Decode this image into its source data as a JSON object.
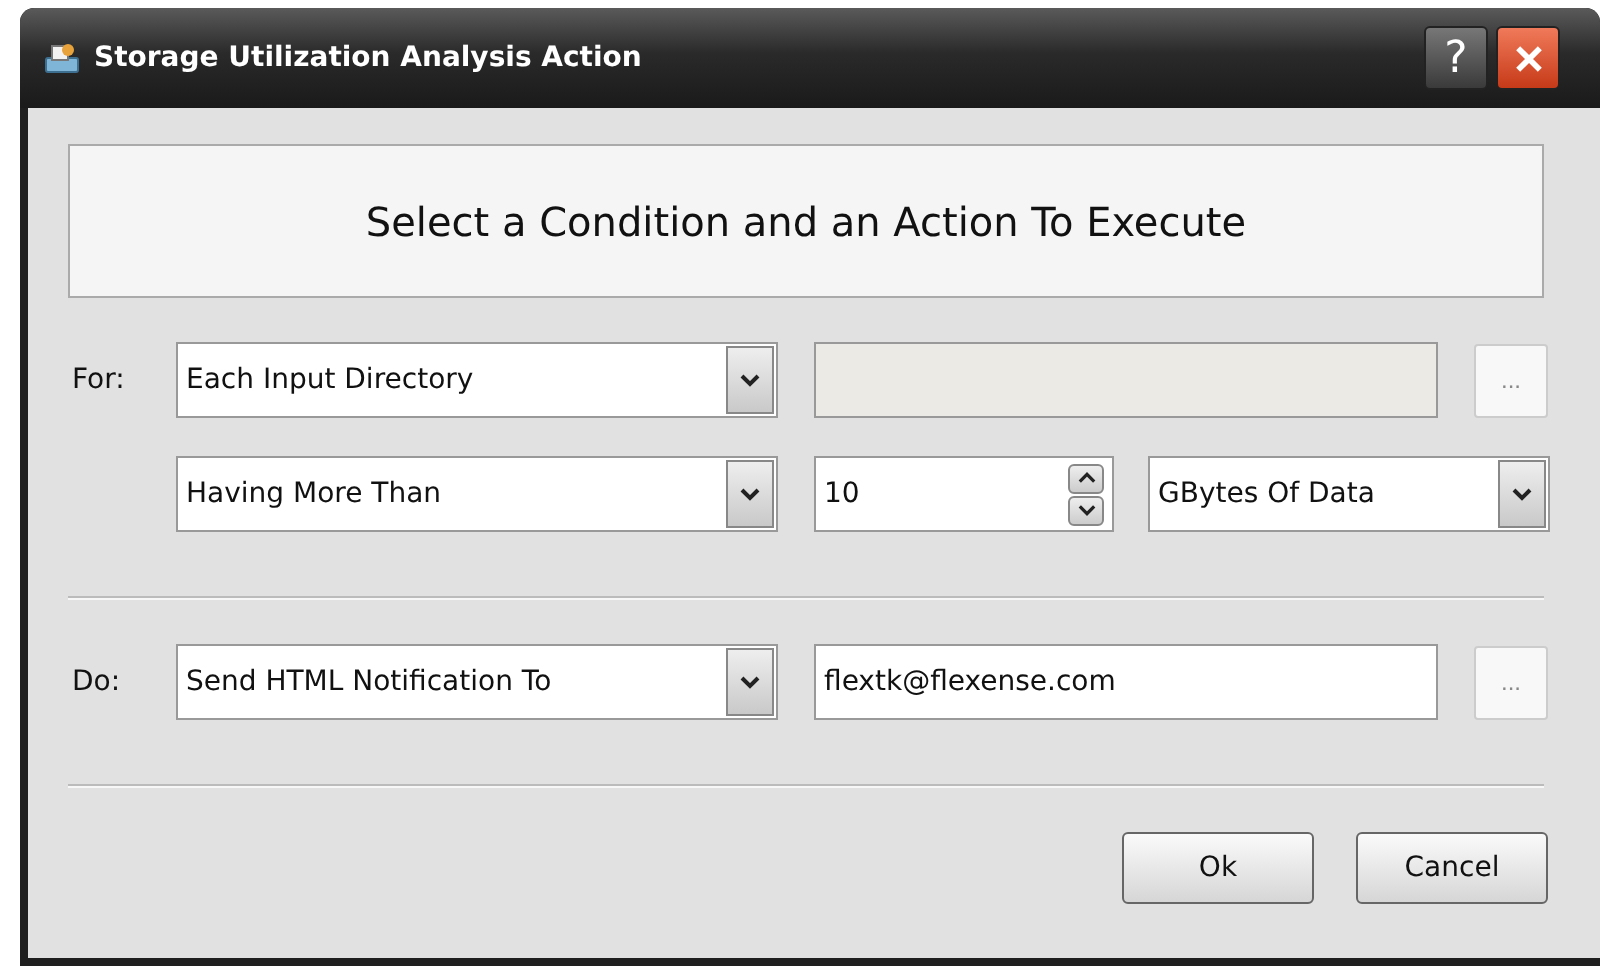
{
  "window": {
    "title": "Storage Utilization Analysis Action",
    "title_buttons": [
      {
        "kind": "help",
        "label": "?"
      },
      {
        "kind": "close"
      }
    ]
  },
  "header": "Select a Condition and an Action To Execute",
  "condition": {
    "label": "For:",
    "target": {
      "kind": "combo",
      "value": "Each Input Directory"
    },
    "path": {
      "kind": "field",
      "disabled": true
    },
    "browse": {
      "label": "..."
    },
    "test": {
      "kind": "combo",
      "value": "Having More Than"
    },
    "amount": {
      "kind": "spinner",
      "value": "10"
    },
    "unit": {
      "kind": "combo",
      "value": "GBytes Of Data"
    }
  },
  "action": {
    "label": "Do:",
    "type": {
      "kind": "combo",
      "value": "Send HTML Notification To"
    },
    "recipient": {
      "kind": "field",
      "value": "flextk@flexense.com",
      "disabled": false
    },
    "browse": {
      "label": "..."
    }
  },
  "buttons": [
    {
      "label": "Ok"
    },
    {
      "label": "Cancel"
    }
  ]
}
